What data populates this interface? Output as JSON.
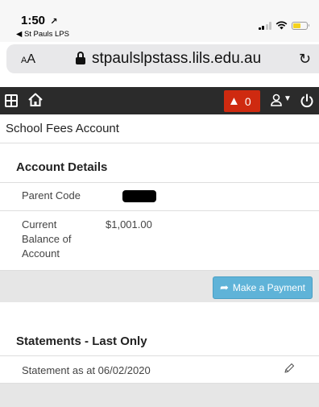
{
  "status_bar": {
    "time": "1:50",
    "location_arrow": "↗",
    "back_app": "◀ St Pauls LPS"
  },
  "browser": {
    "text_size_label": "AA",
    "url": "stpaulslpstass.lils.edu.au",
    "reload_icon": "↻"
  },
  "app_nav": {
    "alert_count": "0",
    "alert_icon": "▲"
  },
  "page": {
    "title": "School Fees Account",
    "account_details": {
      "heading": "Account Details",
      "rows": [
        {
          "label": "Parent Code",
          "value": ""
        },
        {
          "label": "Current Balance of Account",
          "value": "$1,001.00"
        }
      ],
      "pay_button_label": "Make a Payment"
    },
    "statements": {
      "heading": "Statements - Last Only",
      "items": [
        {
          "label": "Statement as at 06/02/2020"
        }
      ]
    }
  },
  "colors": {
    "nav_bg": "#2b2b2b",
    "alert_red": "#cf2a10",
    "pay_button": "#5fb3d8",
    "band_grey": "#e6e6e6"
  }
}
